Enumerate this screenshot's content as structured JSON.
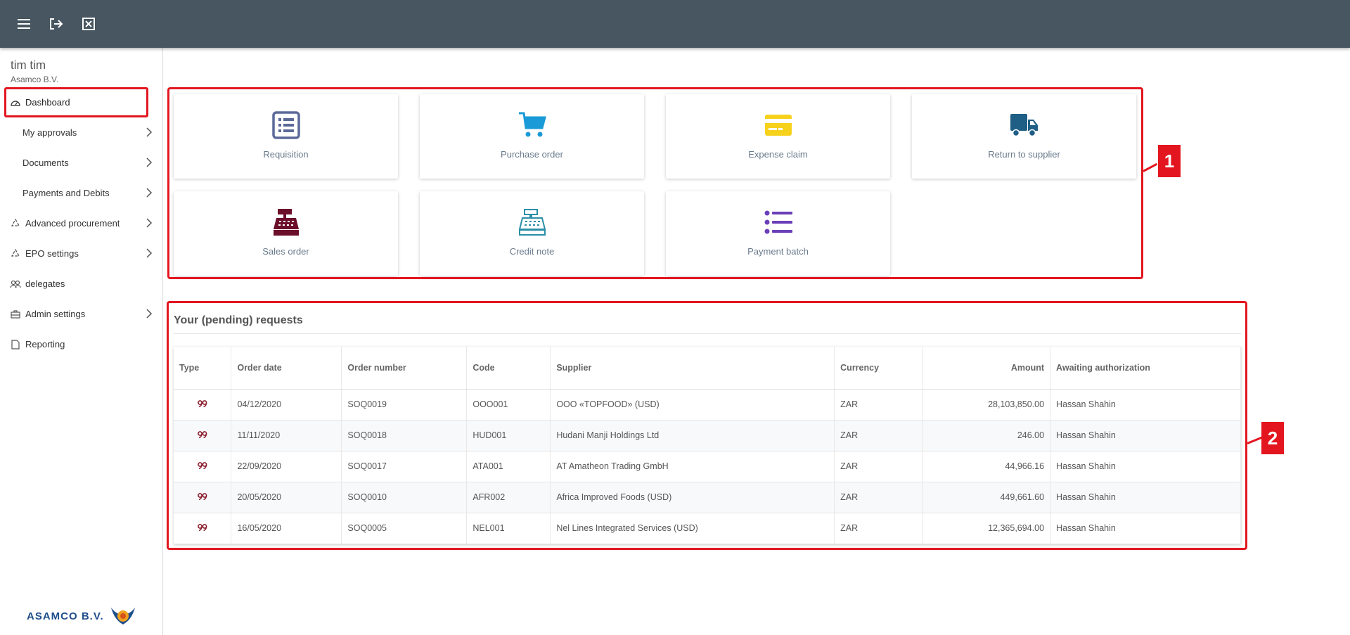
{
  "topbar": {
    "icons": [
      "menu-icon",
      "logout-icon",
      "close-box-icon"
    ]
  },
  "user": {
    "name": "tim tim",
    "company": "Asamco B.V."
  },
  "sidebar": {
    "items": [
      {
        "label": "Dashboard",
        "icon": "dashboard-icon"
      },
      {
        "label": "My approvals"
      },
      {
        "label": "Documents"
      },
      {
        "label": "Payments and Debits"
      },
      {
        "label": "Advanced procurement",
        "icon": "recycle-icon"
      },
      {
        "label": "EPO settings",
        "icon": "recycle-icon"
      },
      {
        "label": "delegates",
        "icon": "people-icon"
      },
      {
        "label": "Admin settings",
        "icon": "briefcase-icon"
      },
      {
        "label": "Reporting",
        "icon": "document-icon"
      }
    ],
    "logo_text": "ASAMCO B.V."
  },
  "tiles": [
    {
      "label": "Requisition",
      "icon": "list-box-icon",
      "color": "#5c6a9a"
    },
    {
      "label": "Purchase order",
      "icon": "cart-icon",
      "color": "#1a9ad6"
    },
    {
      "label": "Expense claim",
      "icon": "credit-card-icon",
      "color": "#f7d21c"
    },
    {
      "label": "Return to supplier",
      "icon": "truck-icon",
      "color": "#1f5f86"
    },
    {
      "label": "Sales order",
      "icon": "cash-register-icon",
      "color": "#6b0f2a"
    },
    {
      "label": "Credit note",
      "icon": "cash-register-outline-icon",
      "color": "#2b8fa8"
    },
    {
      "label": "Payment batch",
      "icon": "bullet-list-icon",
      "color": "#6a3fb8"
    }
  ],
  "annotations": [
    "1",
    "2"
  ],
  "requests": {
    "title": "Your (pending) requests",
    "columns": [
      "Type",
      "Order date",
      "Order number",
      "Code",
      "Supplier",
      "Currency",
      "Amount",
      "Awaiting authorization"
    ],
    "rows": [
      {
        "date": "04/12/2020",
        "number": "SOQ0019",
        "code": "OOO001",
        "supplier": "OOO «TOPFOOD» (USD)",
        "currency": "ZAR",
        "amount": "28,103,850.00",
        "awaiting": "Hassan Shahin"
      },
      {
        "date": "11/11/2020",
        "number": "SOQ0018",
        "code": "HUD001",
        "supplier": "Hudani Manji Holdings Ltd",
        "currency": "ZAR",
        "amount": "246.00",
        "awaiting": "Hassan Shahin"
      },
      {
        "date": "22/09/2020",
        "number": "SOQ0017",
        "code": "ATA001",
        "supplier": "AT Amatheon Trading GmbH",
        "currency": "ZAR",
        "amount": "44,966.16",
        "awaiting": "Hassan Shahin"
      },
      {
        "date": "20/05/2020",
        "number": "SOQ0010",
        "code": "AFR002",
        "supplier": "Africa Improved Foods (USD)",
        "currency": "ZAR",
        "amount": "449,661.60",
        "awaiting": "Hassan Shahin"
      },
      {
        "date": "16/05/2020",
        "number": "SOQ0005",
        "code": "NEL001",
        "supplier": "Nel Lines Integrated Services (USD)",
        "currency": "ZAR",
        "amount": "12,365,694.00",
        "awaiting": "Hassan Shahin"
      }
    ],
    "type_icon": "quote-icon",
    "type_icon_color": "#8b1d2c"
  }
}
